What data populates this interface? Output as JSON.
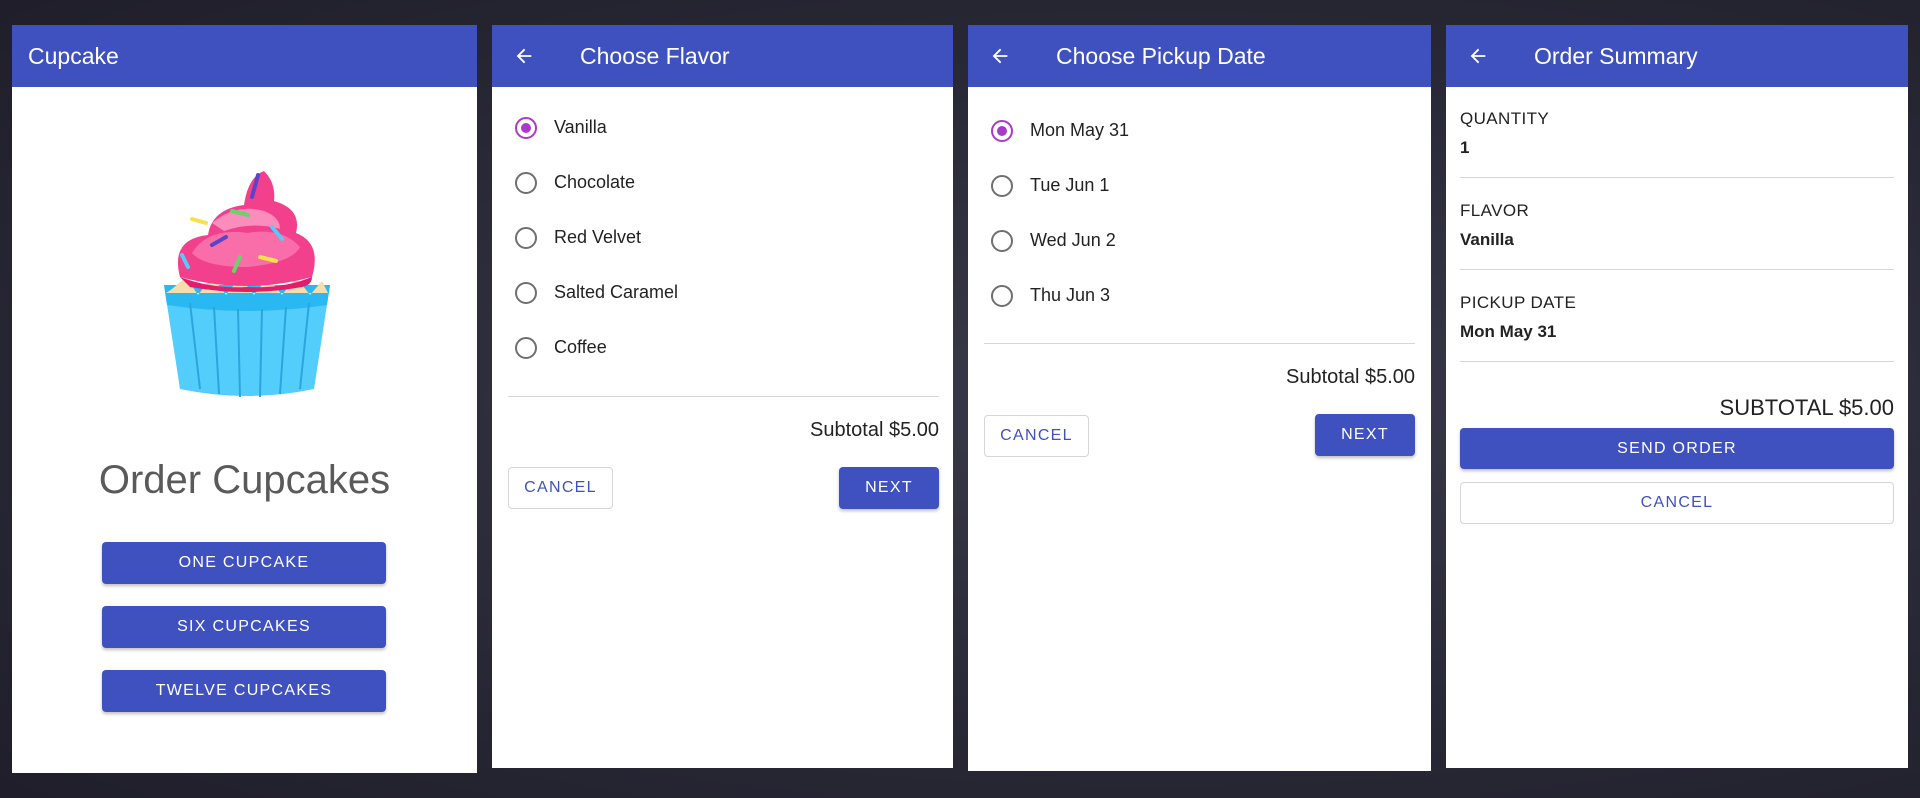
{
  "colors": {
    "primary": "#3f51bf",
    "radio_checked": "#a93bc6",
    "background": "#2a2937"
  },
  "start": {
    "app_title": "Cupcake",
    "heading": "Order Cupcakes",
    "buttons": [
      "ONE CUPCAKE",
      "SIX CUPCAKES",
      "TWELVE CUPCAKES"
    ],
    "image_icon": "cupcake-illustration"
  },
  "flavor": {
    "title": "Choose Flavor",
    "back_icon": "arrow-left-icon",
    "options": [
      {
        "label": "Vanilla",
        "checked": true
      },
      {
        "label": "Chocolate",
        "checked": false
      },
      {
        "label": "Red Velvet",
        "checked": false
      },
      {
        "label": "Salted Caramel",
        "checked": false
      },
      {
        "label": "Coffee",
        "checked": false
      }
    ],
    "subtotal": "Subtotal $5.00",
    "cancel": "CANCEL",
    "next": "NEXT"
  },
  "pickup": {
    "title": "Choose Pickup Date",
    "back_icon": "arrow-left-icon",
    "options": [
      {
        "label": "Mon May 31",
        "checked": true
      },
      {
        "label": "Tue Jun 1",
        "checked": false
      },
      {
        "label": "Wed Jun 2",
        "checked": false
      },
      {
        "label": "Thu Jun 3",
        "checked": false
      }
    ],
    "subtotal": "Subtotal $5.00",
    "cancel": "CANCEL",
    "next": "NEXT"
  },
  "summary": {
    "title": "Order Summary",
    "back_icon": "arrow-left-icon",
    "quantity_label": "QUANTITY",
    "quantity_value": "1",
    "flavor_label": "FLAVOR",
    "flavor_value": "Vanilla",
    "date_label": "PICKUP DATE",
    "date_value": "Mon May 31",
    "subtotal": "SUBTOTAL $5.00",
    "send": "SEND ORDER",
    "cancel": "CANCEL"
  }
}
